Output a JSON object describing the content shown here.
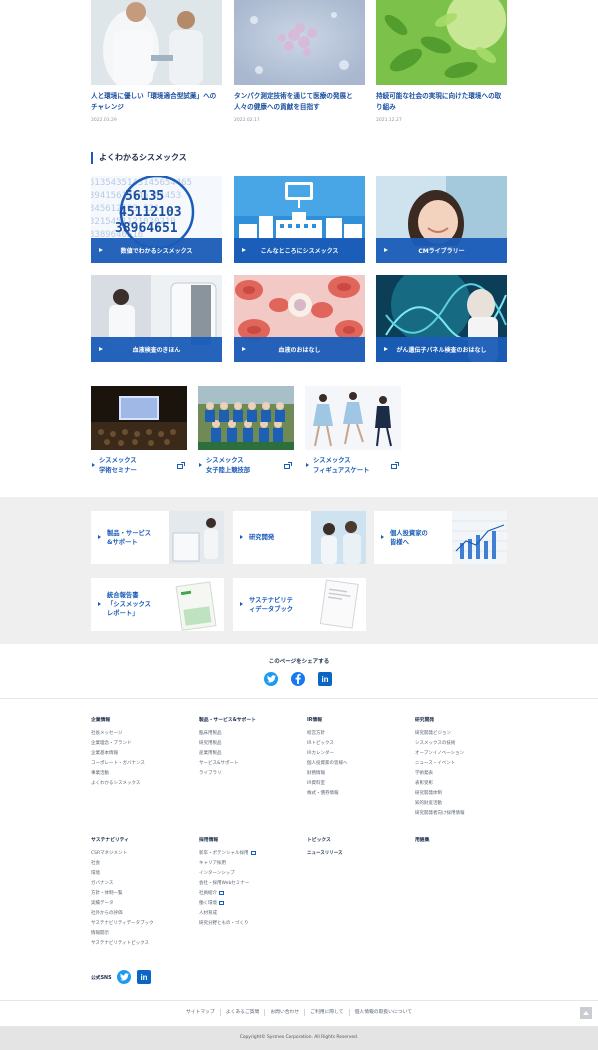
{
  "news": [
    {
      "title": "人と環境に優しい「環境適合型試薬」へのチャレンジ",
      "date": "2022.03.29"
    },
    {
      "title": "タンパク測定技術を通じて医療の発展と人々の健康への貢献を目指す",
      "date": "2022.02.17"
    },
    {
      "title": "持続可能な社会の実現に向けた環境への取り組み",
      "date": "2021.12.27"
    }
  ],
  "section_title": "よくわかるシスメックス",
  "number_art_lines": [
    "5135435143145654465",
    "39415613545 61453",
    "345612103 321",
    "3215451121030210",
    "3389646516 ",
    "5453135 31 5"
  ],
  "tiles": [
    {
      "label": "数値でわかるシスメックス"
    },
    {
      "label": "こんなところにシスメックス"
    },
    {
      "label": "CMライブラリー"
    },
    {
      "label": "血液検査のきほん"
    },
    {
      "label": "血液のおはなし"
    },
    {
      "label": "がん遺伝子パネル検査のおはなし"
    }
  ],
  "events": [
    {
      "line1": "シスメックス",
      "line2": "学術セミナー"
    },
    {
      "line1": "シスメックス",
      "line2": "女子陸上競技部"
    },
    {
      "line1": "シスメックス",
      "line2": "フィギュアスケート"
    }
  ],
  "link_cards": [
    {
      "line1": "製品・サービス",
      "line2": "&サポート"
    },
    {
      "line1": "研究開発",
      "line2": ""
    },
    {
      "line1": "個人投資家の",
      "line2": "皆様へ"
    },
    {
      "line1": "統合報告書",
      "line2": "「シスメックス",
      "line3": "レポート」"
    },
    {
      "line1": "サステナビリテ",
      "line2": "ィデータブック"
    }
  ],
  "share": {
    "title": "このページをシェアする"
  },
  "footer": {
    "columns": [
      {
        "heading": "企業情報",
        "items": [
          "社長メッセージ",
          "企業理念・ブランド",
          "企業基本情報",
          "コーポレート・ガバナンス",
          "事業活動",
          "よくわかるシスメックス"
        ]
      },
      {
        "heading": "製品・サービス&サポート",
        "items": [
          "臨床用製品",
          "研究用製品",
          "産業用製品",
          "サービス&サポート",
          "ライブラリ"
        ]
      },
      {
        "heading": "IR情報",
        "items": [
          "経営方針",
          "IRトピックス",
          "IRカレンダー",
          "個人投資家の皆様へ",
          "財務情報",
          "IR資料室",
          "株式・債券情報"
        ]
      },
      {
        "heading": "研究開発",
        "items": [
          "研究開発ビジョン",
          "シスメックスの技術",
          "オープンイノベーション",
          "ニュース・イベント",
          "学術発表",
          "表彰受彰",
          "研究開発体制",
          "知的財産活動",
          "研究開発者向け採用情報"
        ]
      },
      {
        "heading": "サステナビリティ",
        "items": [
          "CSRマネジメント",
          "社会",
          "環境",
          "ガバナンス",
          "方針・体制一覧",
          "実績データ",
          "社外からの評価",
          "サステナビリティデータブック",
          "情報開示",
          "サステナビリティトピックス"
        ]
      },
      {
        "heading": "採用情報",
        "items": [
          "新卒・ポテンシャル採用",
          "キャリア採用",
          "インターンシップ",
          "会社・採用Webセミナー",
          "社員紹介",
          "働く環境",
          "人材育成",
          "研究分野ともの・づくり"
        ]
      },
      {
        "heading": "トピックス",
        "items": [
          "ニュースリリース"
        ]
      },
      {
        "heading": "用語集",
        "items": []
      }
    ],
    "sns_label": "公式SNS",
    "bottom_links": [
      "サイトマップ",
      "よくあるご質問",
      "お問い合わせ",
      "ご利用に際して",
      "個人情報の取扱いについて"
    ],
    "copyright": "Copyright© Sysmex Corporation. All Rights Reserved."
  },
  "colors": {
    "accent": "#1a5cb8",
    "tile_bar": "#1a5cb8",
    "band": "#efefef",
    "twitter": "#1d9bf0",
    "facebook": "#1877f2",
    "linkedin": "#0a66c2"
  }
}
